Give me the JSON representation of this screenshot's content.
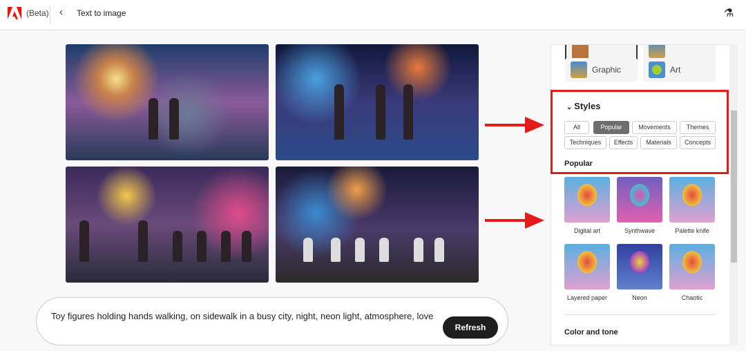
{
  "header": {
    "beta": "(Beta)",
    "title": "Text to image",
    "brand_color": "#fa0f00"
  },
  "images": [
    "generated-1",
    "generated-2",
    "generated-3",
    "generated-4"
  ],
  "prompt": {
    "text": "Toy figures holding hands walking, on sidewalk in a busy city, night, neon light, atmosphere, love",
    "refresh": "Refresh"
  },
  "content_types": [
    {
      "label": "Graphic"
    },
    {
      "label": "Art"
    }
  ],
  "styles": {
    "heading": "Styles",
    "tabs": [
      "All",
      "Popular",
      "Movements",
      "Themes",
      "Techniques",
      "Effects",
      "Materials",
      "Concepts"
    ],
    "active_tab": "Popular",
    "section": "Popular",
    "items": [
      "Digital art",
      "Synthwave",
      "Palette knife",
      "Layered paper",
      "Neon",
      "Chaotic"
    ]
  },
  "color_tone": "Color and tone",
  "annotation_color": "#e51b1b"
}
